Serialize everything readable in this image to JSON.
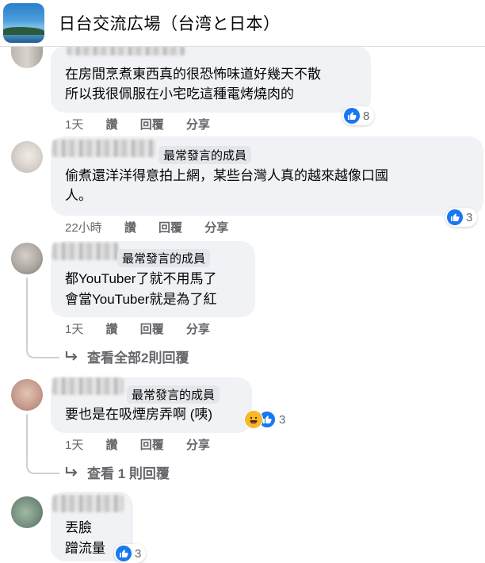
{
  "header": {
    "group_name": "日台交流広場（台湾と日本）"
  },
  "comments": [
    {
      "lines": [
        "在房間烹煮東西真的很恐怖味道好幾天不散",
        "所以我很佩服在小宅吃這種電烤燒肉的"
      ],
      "time": "1天",
      "like": "讚",
      "reply": "回覆",
      "share": "分享",
      "reaction_count": "8"
    },
    {
      "badge": "最常發言的成員",
      "lines": [
        "偷煮還洋洋得意拍上網，某些台灣人真的越來越像口國",
        "人。"
      ],
      "time": "22小時",
      "like": "讚",
      "reply": "回覆",
      "share": "分享",
      "reaction_count": "3"
    },
    {
      "badge": "最常發言的成員",
      "lines": [
        "都YouTuber了就不用馬了",
        "會當YouTuber就是為了紅"
      ],
      "time": "1天",
      "like": "讚",
      "reply": "回覆",
      "share": "分享",
      "replies_link": "查看全部2則回覆"
    },
    {
      "badge": "最常發言的成員",
      "lines": [
        "要也是在吸煙房弄啊 (咦)"
      ],
      "time": "1天",
      "like": "讚",
      "reply": "回覆",
      "share": "分享",
      "reaction_count": "3",
      "replies_link": "查看 1 則回覆"
    },
    {
      "lines": [
        "丟臉",
        "蹭流量"
      ],
      "reaction_count": "3"
    }
  ],
  "colors": {
    "like_blue": "#1877f2",
    "bubble": "#f0f2f5",
    "meta_gray": "#65676b",
    "haha_yellow": "#f7b928"
  },
  "icons": {
    "like": "thumbs-up-icon",
    "haha": "laughing-face-icon",
    "reply_arrow": "reply-arrow-icon"
  }
}
